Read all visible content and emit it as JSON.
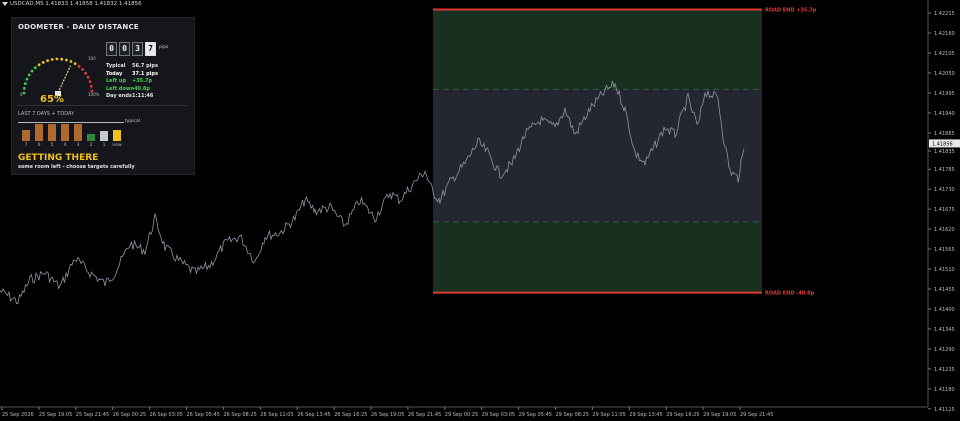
{
  "header": {
    "symbol": "USDCAD,M5",
    "ohlc": "1.41833 1.41858 1.41832 1.41856"
  },
  "colors": {
    "background": "#000000",
    "price": "#8f96a3",
    "zone_green": "#17301f",
    "zone_dark": "#242632",
    "road_end": "#e03a32",
    "accent": "#f0c020"
  },
  "chart": {
    "y_min": 1.4113,
    "y_max": 1.4224,
    "price_ticks": [
      "1.42215",
      "1.42160",
      "1.42105",
      "1.42050",
      "1.41995",
      "1.41940",
      "1.41885",
      "1.41835",
      "1.41785",
      "1.41730",
      "1.41675",
      "1.41620",
      "1.41565",
      "1.41510",
      "1.41455",
      "1.41400",
      "1.41345",
      "1.41290",
      "1.41235",
      "1.41180",
      "1.41125"
    ],
    "current_price": "1.41856",
    "time_ticks": [
      "25 Sep 2026",
      "25 Sep 19:05",
      "25 Sep 21:45",
      "26 Sep 00:25",
      "26 Sep 03:05",
      "26 Sep 05:45",
      "26 Sep 08:25",
      "26 Sep 11:05",
      "26 Sep 13:45",
      "26 Sep 16:25",
      "26 Sep 19:05",
      "26 Sep 21:45",
      "29 Sep 00:25",
      "29 Sep 03:05",
      "29 Sep 05:45",
      "29 Sep 08:25",
      "29 Sep 11:05",
      "29 Sep 13:45",
      "29 Sep 16:25",
      "29 Sep 19:05",
      "29 Sep 21:45"
    ],
    "road_end_upper_price": 1.42225,
    "road_end_lower_price": 1.41445,
    "band_upper_price": 1.42005,
    "band_lower_price": 1.4164,
    "road_end_upper_label": "ROAD END  +35.7p",
    "road_end_lower_label": "ROAD END  -40.8p",
    "path": [
      [
        0,
        1.4145
      ],
      [
        18,
        1.4142
      ],
      [
        30,
        1.4148
      ],
      [
        45,
        1.415
      ],
      [
        60,
        1.4146
      ],
      [
        75,
        1.4154
      ],
      [
        90,
        1.415
      ],
      [
        105,
        1.4147
      ],
      [
        115,
        1.415
      ],
      [
        130,
        1.4158
      ],
      [
        145,
        1.4156
      ],
      [
        155,
        1.4165
      ],
      [
        165,
        1.4157
      ],
      [
        180,
        1.4153
      ],
      [
        195,
        1.415
      ],
      [
        210,
        1.4152
      ],
      [
        225,
        1.4158
      ],
      [
        240,
        1.416
      ],
      [
        255,
        1.4153
      ],
      [
        265,
        1.416
      ],
      [
        280,
        1.4161
      ],
      [
        295,
        1.4165
      ],
      [
        305,
        1.417
      ],
      [
        315,
        1.4167
      ],
      [
        330,
        1.4168
      ],
      [
        345,
        1.4163
      ],
      [
        360,
        1.417
      ],
      [
        375,
        1.4165
      ],
      [
        390,
        1.4172
      ],
      [
        400,
        1.417
      ],
      [
        415,
        1.4175
      ],
      [
        425,
        1.4178
      ],
      [
        433,
        1.4172
      ],
      [
        440,
        1.417
      ],
      [
        450,
        1.4175
      ],
      [
        465,
        1.418
      ],
      [
        478,
        1.4186
      ],
      [
        488,
        1.4183
      ],
      [
        500,
        1.4177
      ],
      [
        512,
        1.418
      ],
      [
        525,
        1.4188
      ],
      [
        540,
        1.4192
      ],
      [
        555,
        1.419
      ],
      [
        565,
        1.4195
      ],
      [
        575,
        1.4188
      ],
      [
        590,
        1.4195
      ],
      [
        605,
        1.42
      ],
      [
        615,
        1.4202
      ],
      [
        625,
        1.4195
      ],
      [
        635,
        1.4183
      ],
      [
        645,
        1.418
      ],
      [
        655,
        1.4185
      ],
      [
        665,
        1.419
      ],
      [
        675,
        1.4188
      ],
      [
        688,
        1.4198
      ],
      [
        698,
        1.419
      ],
      [
        705,
        1.42
      ],
      [
        718,
        1.4198
      ],
      [
        723,
        1.4188
      ],
      [
        730,
        1.4178
      ],
      [
        738,
        1.4176
      ],
      [
        745,
        1.4185
      ]
    ]
  },
  "odometer": {
    "title": "ODOMETER  -  DAILY DISTANCE",
    "digits": [
      "0",
      "0",
      "3",
      "7"
    ],
    "unit": "pips",
    "gauge_min": "0",
    "gauge_max": "100",
    "gauge_mark": "100%",
    "percent": "65%",
    "percent_value": 0.65,
    "stats": [
      {
        "key": "Typical",
        "value": "56.7 pips",
        "color": "#e6e6e6"
      },
      {
        "key": "Today",
        "value": "37.1 pips",
        "color": "#ffffff"
      },
      {
        "key": "Left up",
        "value": "+35.7p",
        "color": "#3ed44a"
      },
      {
        "key": "Left down",
        "value": "-40.8p",
        "color": "#3ed44a"
      },
      {
        "key": "Day ends",
        "value": "1:11:46",
        "color": "#e6e6e6"
      }
    ],
    "history_title": "LAST 7 DAYS + TODAY",
    "typical_label": "typical",
    "history": [
      {
        "label": "7",
        "value": 0.62,
        "color": "#b06a2c"
      },
      {
        "label": "6",
        "value": 0.95,
        "color": "#b06a2c"
      },
      {
        "label": "5",
        "value": 0.95,
        "color": "#b06a2c"
      },
      {
        "label": "4",
        "value": 0.95,
        "color": "#b06a2c"
      },
      {
        "label": "3",
        "value": 0.95,
        "color": "#b06a2c"
      },
      {
        "label": "2",
        "value": 0.4,
        "color": "#2e8a3a"
      },
      {
        "label": "1",
        "value": 0.58,
        "color": "#c8c8c8"
      },
      {
        "label": "now",
        "value": 0.6,
        "color": "#f0c020"
      }
    ],
    "verdict": "GETTING THERE",
    "verdict_sub": "some room left - choose targets carefully"
  }
}
